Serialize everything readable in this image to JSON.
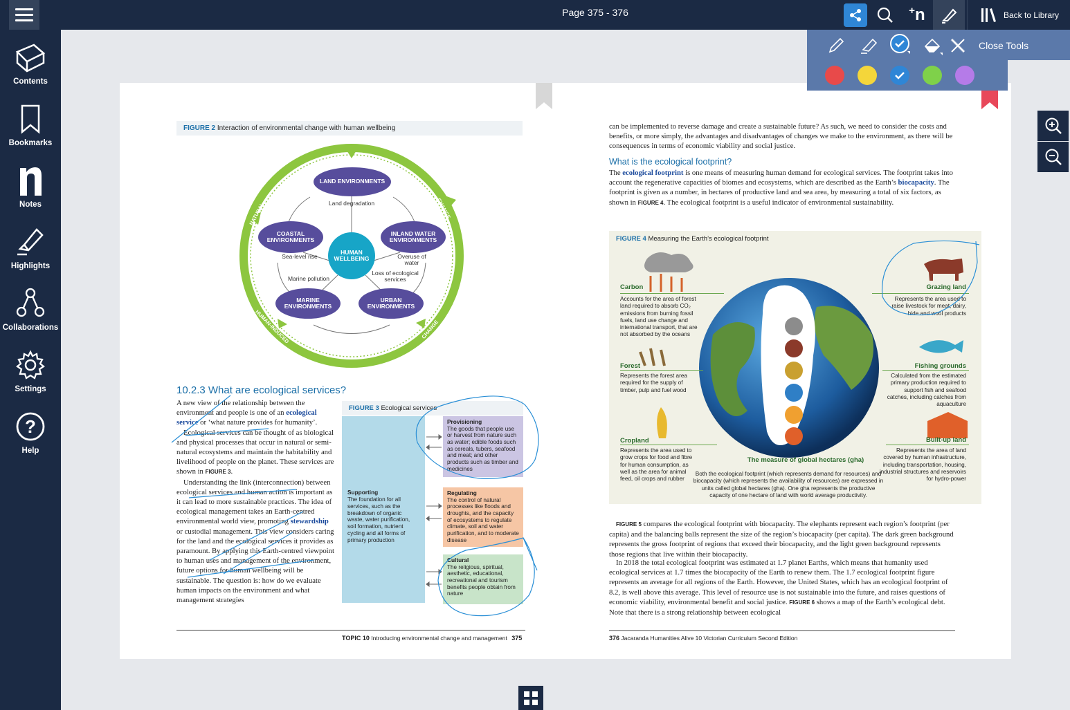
{
  "topbar": {
    "page_indicator": "Page 375 - 376",
    "back_label": "Back to Library"
  },
  "sidebar": {
    "items": [
      {
        "label": "Contents"
      },
      {
        "label": "Bookmarks"
      },
      {
        "label": "Notes"
      },
      {
        "label": "Highlights"
      },
      {
        "label": "Collaborations"
      },
      {
        "label": "Settings"
      },
      {
        "label": "Help"
      }
    ]
  },
  "tools": {
    "close_label": "Close Tools",
    "colors": [
      "#e84a4a",
      "#f4d63a",
      "#2f86d6",
      "#7fd14a",
      "#b57be8"
    ],
    "selected_color": "#2f86d6"
  },
  "left_page": {
    "figure2_label": "FIGURE 2",
    "figure2_title": "Interaction of environmental change with human wellbeing",
    "cycle": {
      "land": "LAND ENVIRONMENTS",
      "coastal": "COASTAL ENVIRONMENTS",
      "inland": "INLAND WATER ENVIRONMENTS",
      "marine": "MARINE ENVIRONMENTS",
      "urban": "URBAN ENVIRONMENTS",
      "human": "HUMAN WELLBEING",
      "land_degradation": "Land degradation",
      "sea_level": "Sea-level rise",
      "overuse": "Overuse of water",
      "marine_pollution": "Marine pollution",
      "loss": "Loss of ecological services",
      "ring_natural": "NATURAL",
      "ring_change_top": "CHANGE",
      "ring_human": "HUMAN-INDUCED",
      "ring_change_bottom": "CHANGE"
    },
    "section_heading": "10.2.3 What are ecological services?",
    "para1_a": "A new view of the relationship between the environment and people is one of an ",
    "para1_kw": "ecological service",
    "para1_b": " or ‘what nature provides for humanity’.",
    "para2": "Ecological services can be thought of as biological and physical processes that occur in natural or semi-natural ecosystems and maintain the habitability and livelihood of people on the planet. These services are shown in ",
    "para2_fig": "FIGURE 3",
    "para3_a": "Understanding the link (interconnection) between ecological services and human action is important as it can lead to more sustainable practices. The idea of ecological management takes an Earth-centred environmental world view, promoting ",
    "para3_kw": "stewardship",
    "para3_b": " or custodial management. This view considers caring for the land and the ecological services it provides as paramount. By applying this Earth-centred viewpoint to human uses and management of the environment, future options for human wellbeing will be sustainable. The question is: how do we evaluate human impacts on the environment and what management strategies",
    "figure3_label": "FIGURE 3",
    "figure3_title": "Ecological services",
    "supporting_title": "Supporting",
    "supporting_text": "The foundation for all services, such as the breakdown of organic waste, water purification, soil formation, nutrient cycling and all forms of primary production",
    "provisioning_title": "Provisioning",
    "provisioning_text": "The goods that people use or harvest from nature such as water; edible foods such as cereals, tubers, seafood and meat; and other products such as timber and medicines",
    "regulating_title": "Regulating",
    "regulating_text": "The control of natural processes like floods and droughts, and the capacity of ecosystems to regulate climate, soil and water purification, and to moderate disease",
    "cultural_title": "Cultural",
    "cultural_text": "The religious, spiritual, aesthetic, educational, recreational and tourism benefits people obtain from nature",
    "footer_topic": "TOPIC 10",
    "footer_text": "Introducing environmental change and management",
    "footer_page": "375"
  },
  "right_page": {
    "para_top": "can be implemented to reverse damage and create a sustainable future? As such, we need to consider the costs and benefits, or more simply, the advantages and disadvantages of changes we make to the environment, as there will be consequences in terms of economic viability and social justice.",
    "subheading": "What is the ecological footprint?",
    "fp_a": "The ",
    "fp_kw1": "ecological footprint",
    "fp_b": " is one means of measuring human demand for ecological services. The footprint takes into account the regenerative capacities of biomes and ecosystems, which are described as the Earth’s ",
    "fp_kw2": "biocapacity",
    "fp_c": ". The footprint is given as a number, in hectares of productive land and sea area, by measuring a total of six factors, as shown in ",
    "fp_fig": "FIGURE 4",
    "fp_d": ". The ecological footprint is a useful indicator of environmental sustainability.",
    "figure4_label": "FIGURE 4",
    "figure4_title": "Measuring the Earth’s ecological footprint",
    "carbon_h": "Carbon",
    "carbon_t": "Accounts for the area of forest land required to absorb CO₂ emissions from burning fossil fuels, land use change and international transport, that are not absorbed by the oceans",
    "forest_h": "Forest",
    "forest_t": "Represents the forest area required for the supply of timber, pulp and fuel wood",
    "cropland_h": "Cropland",
    "cropland_t": "Represents the area used to grow crops for food and fibre for human consumption, as well as the area for animal feed, oil crops and rubber",
    "grazing_h": "Grazing land",
    "grazing_t": "Represents the area used to raise livestock for meat, dairy, hide and wool products",
    "fishing_h": "Fishing grounds",
    "fishing_t": "Calculated from the estimated primary production required to support fish and seafood catches, including catches from aquaculture",
    "builtup_h": "Built-up land",
    "builtup_t": "Represents the area of land covered by human infrastructure, including transportation, housing, industrial structures and reservoirs for hydro-power",
    "gha_title": "The measure of global hectares (gha)",
    "gha_text": "Both the ecological footprint (which represents demand for resources) and biocapacity (which represents the availability of resources) are expressed in units called global hectares (gha). One gha represents the productive capacity of one hectare of land with world average productivity.",
    "fig5_ref": "FIGURE 5",
    "p5": " compares the ecological footprint with biocapacity. The elephants represent each region’s footprint (per capita) and the balancing balls represent the size of the region’s biocapacity (per capita). The dark green background represents the gross footprint of regions that exceed their biocapacity, and the light green background represents those regions that live within their biocapacity.",
    "p6": "In 2018 the total ecological footprint was estimated at 1.7 planet Earths, which means that humanity used ecological services at 1.7 times the biocapacity of the Earth to renew them. The 1.7 ecological footprint figure represents an average for all regions of the Earth. However, the United States, which has an ecological footprint of 8.2, is well above this average. This level of resource use is not sustainable into the future, and raises questions of economic viability, environmental benefit and social justice. ",
    "fig6_ref": "FIGURE 6",
    "p6_b": " shows a map of the Earth’s ecological debt. Note that there is a strong relationship between ecological",
    "footer_page": "376",
    "footer_text": "Jacaranda Humanities Alive 10 Victorian Curriculum Second Edition"
  }
}
